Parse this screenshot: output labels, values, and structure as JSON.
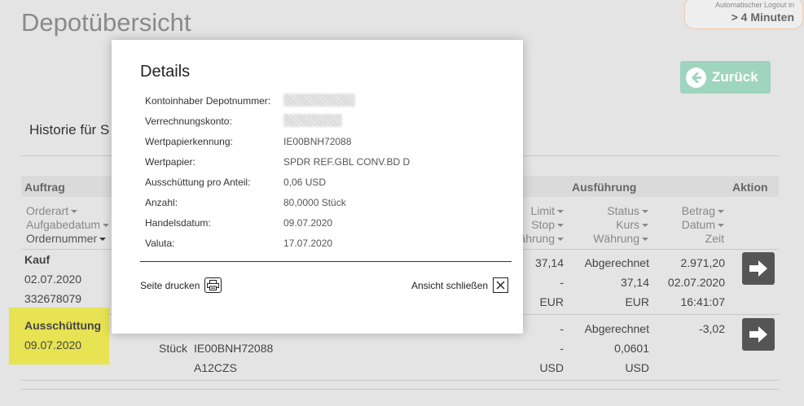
{
  "page": {
    "title": "Depotübersicht",
    "history_title": "Historie für S"
  },
  "logout": {
    "label": "Automatischer Logout in",
    "value": "> 4 Minuten"
  },
  "back_button": {
    "label": "Zurück"
  },
  "table": {
    "group_headers": {
      "auftrag": "Auftrag",
      "ausfuehrung": "Ausführung",
      "aktion": "Aktion"
    },
    "col_left": [
      "Orderart",
      "Aufgabedatum",
      "Ordernummer"
    ],
    "col_limit": [
      "Limit",
      "Stop",
      "ährung"
    ],
    "col_status": [
      "Status",
      "Kurs",
      "Währung"
    ],
    "col_betrag": [
      "Betrag",
      "Datum",
      "Zeit"
    ],
    "rows": [
      {
        "type": "Kauf",
        "date": "02.07.2020",
        "number": "332678079",
        "limit": [
          "37,14",
          "-",
          "EUR"
        ],
        "status": [
          "Abgerechnet",
          "37,14",
          "EUR"
        ],
        "betrag": [
          "2.971,20",
          "02.07.2020",
          "16:41:07"
        ]
      },
      {
        "type": "Ausschüttung",
        "date": "09.07.2020",
        "unit": "Stück",
        "isin": "IE00BNH72088",
        "wkn": "A12CZS",
        "limit": [
          "-",
          "-",
          "USD"
        ],
        "status": [
          "Abgerechnet",
          "0,0601",
          "USD"
        ],
        "betrag": [
          "-3,02"
        ]
      }
    ]
  },
  "modal": {
    "title": "Details",
    "fields": [
      {
        "label": "Kontoinhaber Depotnummer:",
        "value": ""
      },
      {
        "label": "Verrechnungskonto:",
        "value": ""
      },
      {
        "label": "Wertpapierkennung:",
        "value": "IE00BNH72088"
      },
      {
        "label": "Wertpapier:",
        "value": "SPDR REF.GBL CONV.BD D"
      },
      {
        "label": "Ausschüttung pro Anteil:",
        "value": "0,06 USD"
      },
      {
        "label": "Anzahl:",
        "value": "80,0000 Stück"
      },
      {
        "label": "Handelsdatum:",
        "value": "09.07.2020"
      },
      {
        "label": "Valuta:",
        "value": "17.07.2020"
      }
    ],
    "print_label": "Seite drucken",
    "close_label": "Ansicht schließen"
  },
  "colors": {
    "accent_green": "#9fd4bf",
    "highlight": "#e8e33a",
    "dark_button": "#555555"
  }
}
